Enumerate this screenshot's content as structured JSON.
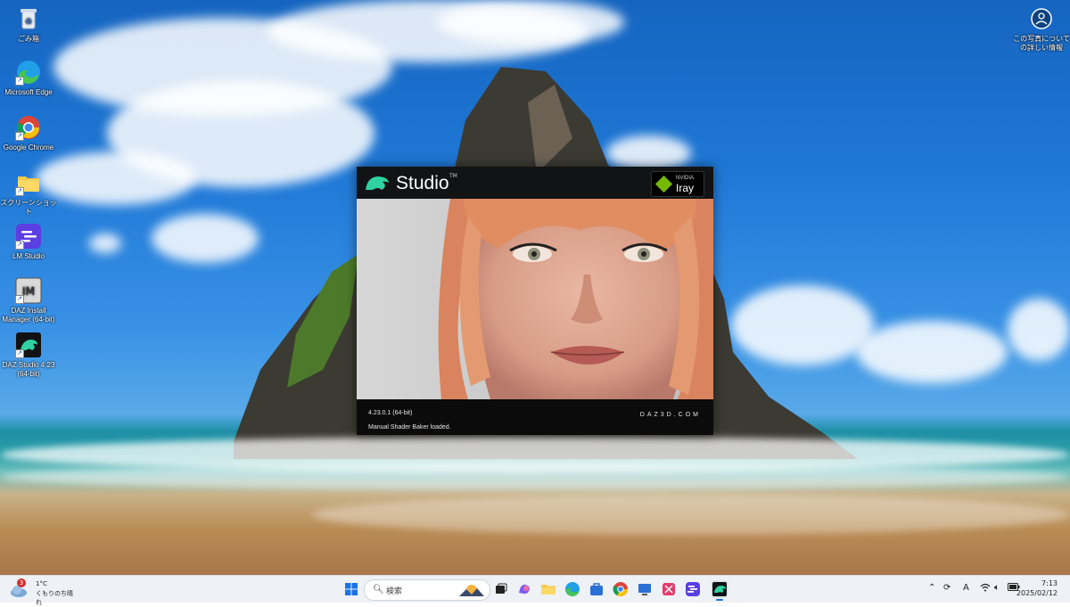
{
  "desktop": {
    "icons": [
      {
        "label": "ごみ箱"
      },
      {
        "label": "Microsoft Edge"
      },
      {
        "label": "Google Chrome"
      },
      {
        "label": "スクリーンショット"
      },
      {
        "label": "LM Studio"
      },
      {
        "label": "DAZ Install Manager (64-bit)"
      },
      {
        "label": "DAZ Studio 4.23 (64-bit)"
      }
    ],
    "info_icon_label": "この写真についての詳しい情報"
  },
  "splash": {
    "title": "Studio",
    "trademark": "TM",
    "iray_vendor": "NVIDIA.",
    "iray_name": "Iray",
    "version": "4.23.0.1 (64-bit)",
    "site": "DAZ3D.COM",
    "status": "Manual Shader Baker loaded."
  },
  "taskbar": {
    "weather_badge": "3",
    "weather_temp": "1°C",
    "weather_desc": "くもりのち晴れ",
    "search_placeholder": "検索",
    "time": "7:13",
    "date": "2025/02/12",
    "ime": "A"
  },
  "colors": {
    "daz_green": "#2fd2a0",
    "nvidia_green": "#76b900",
    "taskbar_bg": "#eef1f5"
  }
}
